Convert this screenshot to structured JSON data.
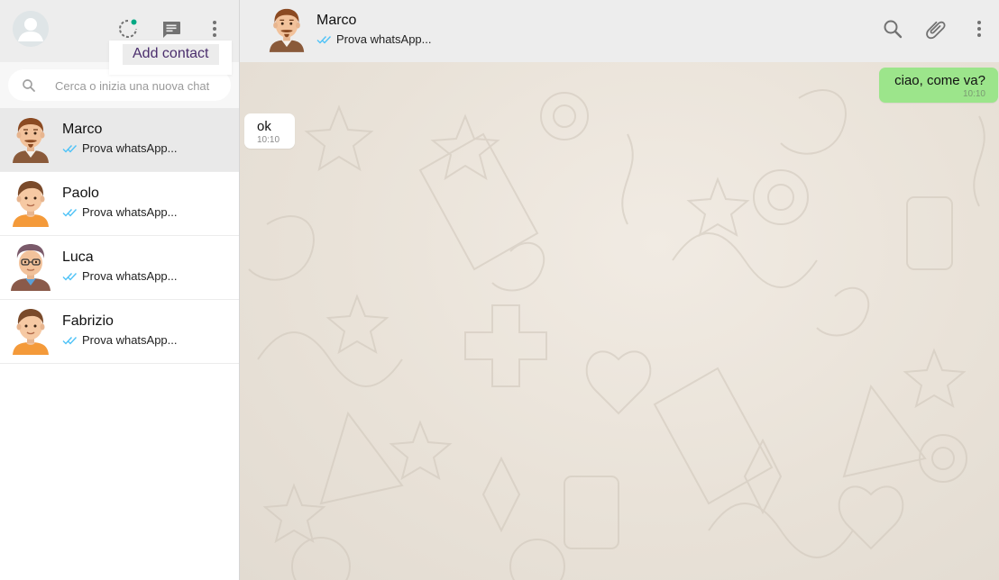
{
  "sidebar": {
    "tooltip": "Add contact",
    "search_placeholder": "Cerca o inizia una nuova chat",
    "contacts": [
      {
        "name": "Marco",
        "preview": "Prova whatsApp...",
        "active": true
      },
      {
        "name": "Paolo",
        "preview": "Prova whatsApp...",
        "active": false
      },
      {
        "name": "Luca",
        "preview": "Prova whatsApp...",
        "active": false
      },
      {
        "name": "Fabrizio",
        "preview": "Prova whatsApp...",
        "active": false
      }
    ],
    "icons": [
      "avatar-placeholder-icon",
      "status-icon",
      "new-chat-icon",
      "menu-icon",
      "search-icon"
    ]
  },
  "chat": {
    "contact_name": "Marco",
    "contact_status": "Prova whatsApp...",
    "icons": [
      "search-icon",
      "attach-icon",
      "menu-icon"
    ],
    "messages": [
      {
        "direction": "sent",
        "text": "ciao, come va?",
        "time": "10:10"
      },
      {
        "direction": "received",
        "text": "ok",
        "time": "10:10"
      }
    ]
  },
  "colors": {
    "header_bg": "#ededed",
    "sent_bubble": "#9ce58b",
    "received_bubble": "#ffffff",
    "read_ticks": "#4fc3f7",
    "status_dot": "#00a884",
    "tooltip_text": "#4b2e6d"
  }
}
